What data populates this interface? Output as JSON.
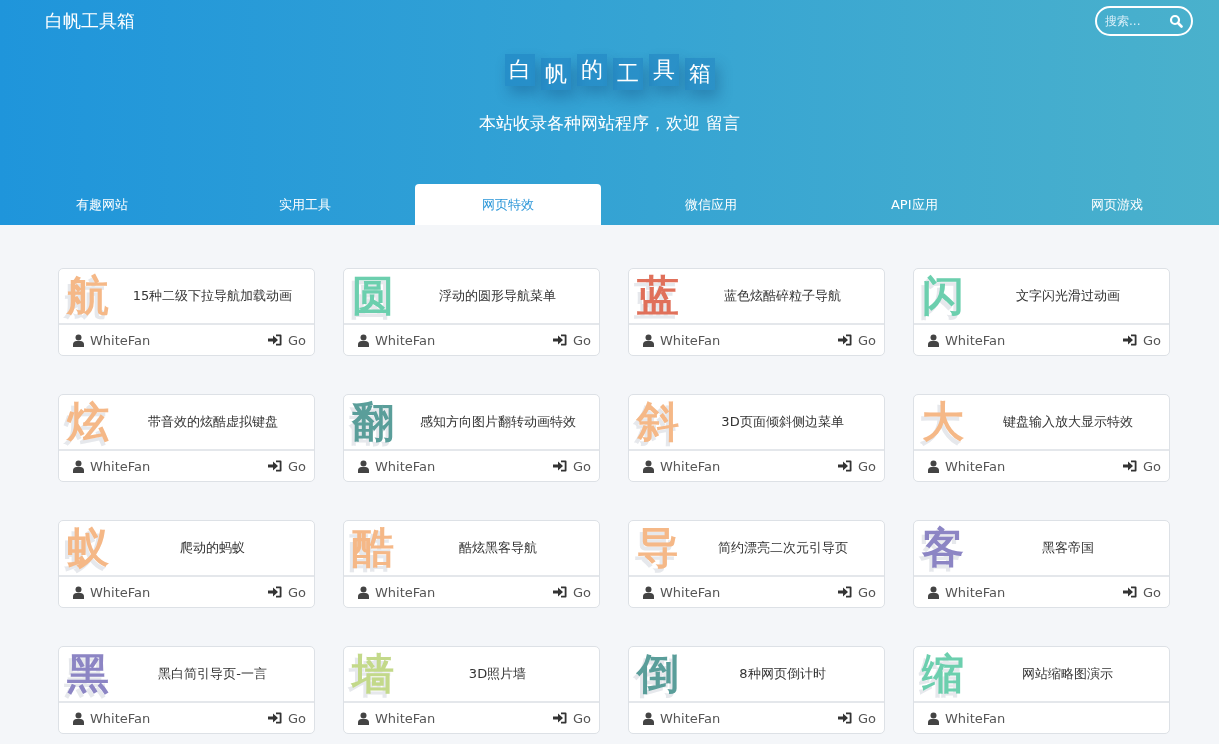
{
  "site_title": "白帆工具箱",
  "search": {
    "placeholder": "搜索..."
  },
  "hero": {
    "title_chars": [
      "白",
      "帆",
      "的",
      "工",
      "具",
      "箱"
    ],
    "subtitle": "本站收录各种网站程序，欢迎 留言"
  },
  "tabs": [
    {
      "label": "有趣网站",
      "selected": false
    },
    {
      "label": "实用工具",
      "selected": false
    },
    {
      "label": "网页特效",
      "selected": true
    },
    {
      "label": "微信应用",
      "selected": false
    },
    {
      "label": "API应用",
      "selected": false
    },
    {
      "label": "网页游戏",
      "selected": false
    }
  ],
  "cards": [
    {
      "glyph": "航",
      "color": "#f5b887",
      "title": "15种二级下拉导航加载动画",
      "author": "WhiteFan",
      "go": "Go"
    },
    {
      "glyph": "圆",
      "color": "#6ccfae",
      "title": "浮动的圆形导航菜单",
      "author": "WhiteFan",
      "go": "Go"
    },
    {
      "glyph": "蓝",
      "color": "#e0705a",
      "title": "蓝色炫酷碎粒子导航",
      "author": "WhiteFan",
      "go": "Go"
    },
    {
      "glyph": "闪",
      "color": "#6ccfae",
      "title": "文字闪光滑过动画",
      "author": "WhiteFan",
      "go": "Go"
    },
    {
      "glyph": "炫",
      "color": "#f5b887",
      "title": "带音效的炫酷虚拟键盘",
      "author": "WhiteFan",
      "go": "Go"
    },
    {
      "glyph": "翻",
      "color": "#5a9e9a",
      "title": "感知方向图片翻转动画特效",
      "author": "WhiteFan",
      "go": "Go"
    },
    {
      "glyph": "斜",
      "color": "#f5b887",
      "title": "3D页面倾斜侧边菜单",
      "author": "WhiteFan",
      "go": "Go"
    },
    {
      "glyph": "大",
      "color": "#f5b887",
      "title": "键盘输入放大显示特效",
      "author": "WhiteFan",
      "go": "Go"
    },
    {
      "glyph": "蚁",
      "color": "#f5b887",
      "title": "爬动的蚂蚁",
      "author": "WhiteFan",
      "go": "Go"
    },
    {
      "glyph": "酷",
      "color": "#f5b887",
      "title": "酷炫黑客导航",
      "author": "WhiteFan",
      "go": "Go"
    },
    {
      "glyph": "导",
      "color": "#f5b887",
      "title": "简约漂亮二次元引导页",
      "author": "WhiteFan",
      "go": "Go"
    },
    {
      "glyph": "客",
      "color": "#8c85c4",
      "title": "黑客帝国",
      "author": "WhiteFan",
      "go": "Go"
    },
    {
      "glyph": "黑",
      "color": "#8c85c4",
      "title": "黑白简引导页-一言",
      "author": "WhiteFan",
      "go": "Go"
    },
    {
      "glyph": "墙",
      "color": "#c3d98a",
      "title": "3D照片墙",
      "author": "WhiteFan",
      "go": "Go"
    },
    {
      "glyph": "倒",
      "color": "#5a9e9a",
      "title": "8种网页倒计时",
      "author": "WhiteFan",
      "go": "Go"
    },
    {
      "glyph": "缩",
      "color": "#6ccfae",
      "title": "网站缩略图演示",
      "author": "WhiteFan"
    }
  ]
}
